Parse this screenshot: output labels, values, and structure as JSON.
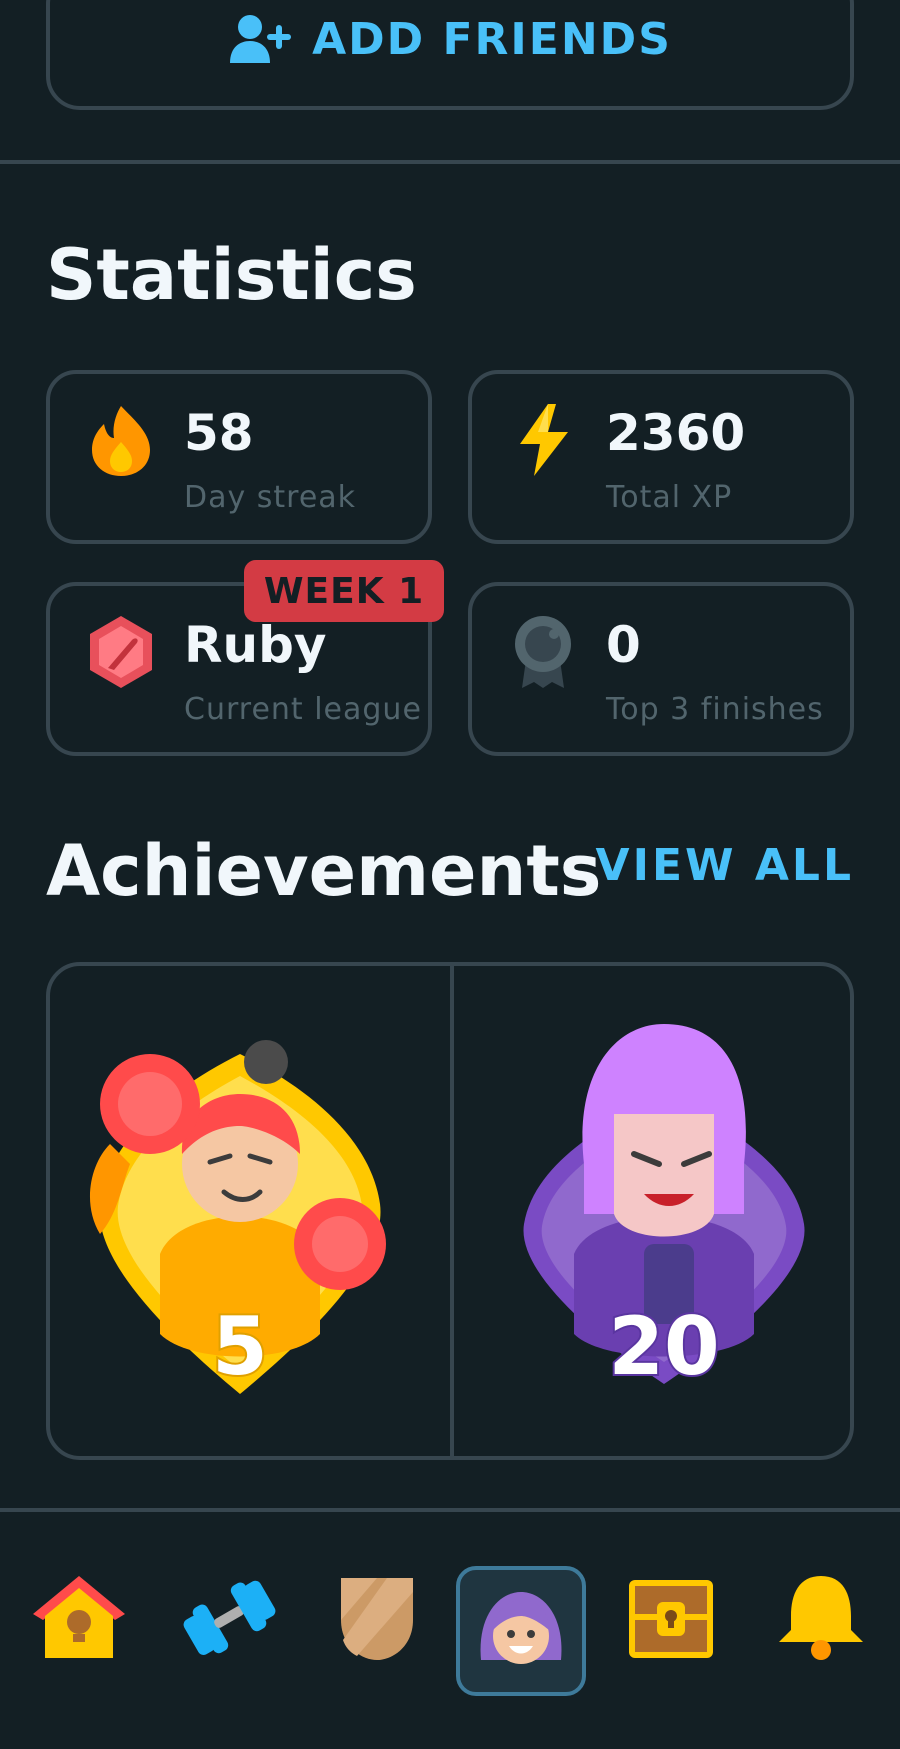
{
  "friends": {
    "label": "ADD FRIENDS",
    "icon": "add-user-icon"
  },
  "statistics": {
    "title": "Statistics",
    "cards": [
      {
        "value": "58",
        "label": "Day streak",
        "icon": "flame-icon"
      },
      {
        "value": "2360",
        "label": "Total XP",
        "icon": "lightning-icon"
      },
      {
        "value": "Ruby",
        "label": "Current league",
        "icon": "ruby-league-icon",
        "badge": "WEEK 1"
      },
      {
        "value": "0",
        "label": "Top 3 finishes",
        "icon": "medal-icon"
      }
    ]
  },
  "achievements": {
    "title": "Achievements",
    "view_all": "VIEW ALL",
    "items": [
      {
        "level": "5",
        "icon": "boxer-achievement-icon",
        "color": "#ffc800"
      },
      {
        "level": "20",
        "icon": "night-owl-achievement-icon",
        "color": "#9069cd"
      }
    ]
  },
  "nav": {
    "items": [
      {
        "icon": "home-icon"
      },
      {
        "icon": "dumbbell-icon"
      },
      {
        "icon": "shield-icon"
      },
      {
        "icon": "profile-avatar-icon",
        "selected": true
      },
      {
        "icon": "treasure-chest-icon"
      },
      {
        "icon": "bell-icon"
      }
    ]
  },
  "colors": {
    "background": "#131f24",
    "border": "#37464f",
    "accent_blue": "#49c0f8",
    "muted_text": "#52656d",
    "badge_red": "#d33b44"
  }
}
